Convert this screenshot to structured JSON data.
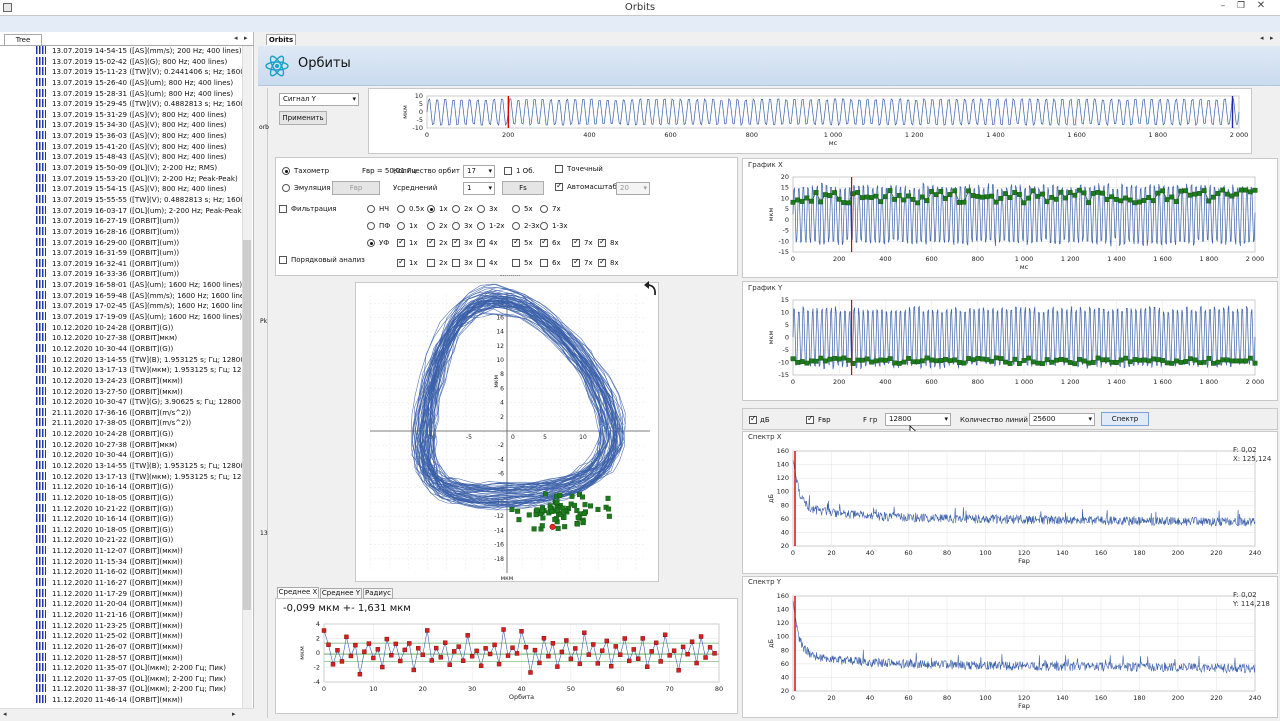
{
  "window": {
    "title": "Orbits"
  },
  "left": {
    "tab": "Tree",
    "items": [
      "13.07.2019 14-54-15 ([AS](mm/s); 200 Hz; 400 lines)",
      "13.07.2019 15-02-42 ([AS](G); 800 Hz; 400 lines)",
      "13.07.2019 15-11-23 ([TW](V); 0.2441406 s; Hz; 1600 Hz)",
      "13.07.2019 15-26-40 ([AS](um); 800 Hz; 400 lines)",
      "13.07.2019 15-28-31 ([AS](um); 800 Hz; 400 lines)",
      "13.07.2019 15-29-45 ([TW](V); 0.4882813 s; Hz; 1600 Hz)",
      "13.07.2019 15-31-29 ([AS](V); 800 Hz; 400 lines)",
      "13.07.2019 15-34-30 ([AS](V); 800 Hz; 400 lines)",
      "13.07.2019 15-36-03 ([AS](V); 800 Hz; 400 lines)",
      "13.07.2019 15-41-20 ([AS](V); 800 Hz; 400 lines)",
      "13.07.2019 15-48-43 ([AS](V); 800 Hz; 400 lines)",
      "13.07.2019 15-50-09 ([OL](V); 2-200 Hz; RMS)",
      "13.07.2019 15-53-20 ([OL](V); 2-200 Hz; Peak-Peak)",
      "13.07.2019 15-54-15 ([AS](V); 800 Hz; 400 lines)",
      "13.07.2019 15-55-55 ([TW](V); 0.4882813 s; Hz; 1600 Hz)",
      "13.07.2019 16-03-17 ([OL](um); 2-200 Hz; Peak-Peak)",
      "13.07.2019 16-27-19 ([ORBIT](um))",
      "13.07.2019 16-28-16 ([ORBIT](um))",
      "13.07.2019 16-29-00 ([ORBIT](um))",
      "13.07.2019 16-31-59 ([ORBIT](um))",
      "13.07.2019 16-32-41 ([ORBIT](um))",
      "13.07.2019 16-33-36 ([ORBIT](um))",
      "13.07.2019 16-58-01 ([AS](um); 1600 Hz; 1600 lines)",
      "13.07.2019 16-59-48 ([AS](mm/s); 1600 Hz; 1600 lines)",
      "13.07.2019 17-02-45 ([AS](mm/s); 1600 Hz; 1600 lines)",
      "13.07.2019 17-19-09 ([AS](um); 1600 Hz; 1600 lines)",
      "10.12.2020 10-24-28 ([ORBIT](G))",
      "10.12.2020 10-27-38 ([ORBIT]мкм)",
      "10.12.2020 10-30-44 ([ORBIT](G))",
      "10.12.2020 13-14-55 ([TW](B); 1.953125 s; Гц; 12800 Hz)",
      "10.12.2020 13-17-13 ([TW](мкм); 1.953125 s; Гц; 12800 H",
      "10.12.2020 13-24-23 ([ORBIT](мкм))",
      "10.12.2020 13-27-50 ([ORBIT](мкм))",
      "10.12.2020 10-30-47 ([TW](G); 3.90625 s; Гц; 12800 Hz)",
      "21.11.2020 17-36-16 ([ORBIT](m/s^2))",
      "21.11.2020 17-38-05 ([ORBIT](m/s^2))",
      "10.12.2020 10-24-28 ([ORBIT](G))",
      "10.12.2020 10-27-38 ([ORBIT]мкм)",
      "10.12.2020 10-30-44 ([ORBIT](G))",
      "10.12.2020 13-14-55 ([TW](B); 1.953125 s; Гц; 12800 Hz)",
      "10.12.2020 13-17-13 ([TW](мкм); 1.953125 s; Гц; 12800 H",
      "11.12.2020 10-16-14 ([ORBIT](G))",
      "11.12.2020 10-18-05 ([ORBIT](G))",
      "11.12.2020 10-21-22 ([ORBIT](G))",
      "11.12.2020 10-16-14 ([ORBIT](G))",
      "11.12.2020 10-18-05 ([ORBIT](G))",
      "11.12.2020 10-21-22 ([ORBIT](G))",
      "11.12.2020 11-12-07 ([ORBIT](мкм))",
      "11.12.2020 11-15-34 ([ORBIT](мкм))",
      "11.12.2020 11-16-02 ([ORBIT](мкм))",
      "11.12.2020 11-16-27 ([ORBIT](мкм))",
      "11.12.2020 11-17-29 ([ORBIT](мкм))",
      "11.12.2020 11-20-04 ([ORBIT](мкм))",
      "11.12.2020 11-21-16 ([ORBIT](мкм))",
      "11.12.2020 11-23-25 ([ORBIT](мкм))",
      "11.12.2020 11-25-02 ([ORBIT](мкм))",
      "11.12.2020 11-26-07 ([ORBIT](мкм))",
      "11.12.2020 11-28-57 ([ORBIT](мкм))",
      "11.12.2020 11-35-07 ([OL](мкм); 2-200 Гц; Пик)",
      "11.12.2020 11-37-05 ([OL](мкм); 2-200 Гц; Пик)",
      "11.12.2020 11-38-37 ([OL](мкм); 2-200 Гц; Пик)",
      "11.12.2020 11-46-14 ([ORBIT](мкм))"
    ]
  },
  "tab": {
    "label": "Orbits"
  },
  "header": {
    "title": "Орбиты"
  },
  "signal": {
    "select": "Сигнал Y",
    "apply": "Применить"
  },
  "side_labels": {
    "a": "orb",
    "b": "Pk",
    "c": "13"
  },
  "settings": {
    "tacho": "Тахометр",
    "fvr": "Fвр = 50,01 Гц",
    "orbit_count_label": "Количество орбит",
    "orbit_count": "17",
    "one_rev": "1 Об.",
    "dotted": "Точечный",
    "emulation": "Эмуляция",
    "fvr_btn": "Fвр",
    "avg_label": "Усреднений",
    "avg": "1",
    "fs_btn": "Fs",
    "autoscale": "Автомасштаб",
    "autoscale_val": "20",
    "filtering": "Фильтрация",
    "order": "Порядковый анализ",
    "row1": {
      "lead": "НЧ",
      "items": [
        "0.5x",
        "1x",
        "2x",
        "3x",
        "5x",
        "7x"
      ]
    },
    "row2": {
      "lead": "ПФ",
      "items": [
        "1x",
        "2x",
        "3x",
        "1-2x",
        "2-3x",
        "1-3x"
      ]
    },
    "row3": {
      "lead": "УФ",
      "items": [
        "1x",
        "2x",
        "3x",
        "4x",
        "5x",
        "6x",
        "7x",
        "8x"
      ]
    },
    "row4": {
      "items": [
        "1x",
        "2x",
        "3x",
        "4x",
        "5x",
        "6x",
        "7x",
        "8x"
      ]
    }
  },
  "bottom": {
    "tabs": [
      "Среднее X",
      "Среднее Y",
      "Радиус"
    ],
    "value": "-0,099 мкм +- 1,631 мкм",
    "xlabel": "Орбита",
    "ylabel": "мкм"
  },
  "spec_ctrl": {
    "db": "дБ",
    "fvr": "Fвр",
    "fgr_label": "F гр",
    "fgr": "12800",
    "lines_label": "Количество линий",
    "lines": "25600",
    "btn": "Спектр"
  },
  "charts": {
    "top": {
      "ylabel": "мкм",
      "xlabel": "мс",
      "yticks": [
        "10",
        "5",
        "0",
        "-5",
        "-10"
      ],
      "xticks": [
        "0",
        "200",
        "400",
        "600",
        "800",
        "1 000",
        "1 200",
        "1 400",
        "1 600",
        "1 800",
        "2 000"
      ]
    },
    "gx": {
      "title": "График X",
      "ylabel": "мкм",
      "xlabel": "мс",
      "yticks": [
        "20",
        "15",
        "10",
        "5",
        "0",
        "-5",
        "-10",
        "-15"
      ],
      "xticks": [
        "0",
        "200",
        "400",
        "600",
        "800",
        "1 000",
        "1 200",
        "1 400",
        "1 600",
        "1 800",
        "2 000"
      ]
    },
    "gy": {
      "title": "График Y",
      "ylabel": "мкм",
      "yticks": [
        "15",
        "10",
        "5",
        "0",
        "-5",
        "-10",
        "-15"
      ],
      "xticks": [
        "0",
        "200",
        "400",
        "600",
        "800",
        "1 000",
        "1 200",
        "1 400",
        "1 600",
        "1 800",
        "2 000"
      ]
    },
    "sx": {
      "title": "Спектр X",
      "ylabel": "дБ",
      "xlabel": "Fвр",
      "info1": "F: 0,02",
      "info2": "X: 125,124",
      "yticks": [
        "160",
        "140",
        "120",
        "100",
        "80",
        "60",
        "40",
        "20"
      ],
      "xticks": [
        "0",
        "20",
        "40",
        "60",
        "80",
        "100",
        "120",
        "140",
        "160",
        "180",
        "200",
        "220",
        "240"
      ]
    },
    "sy": {
      "title": "Спектр Y",
      "ylabel": "дБ",
      "xlabel": "Fвр",
      "info1": "F: 0,02",
      "info2": "Y: 114,218",
      "yticks": [
        "160",
        "140",
        "120",
        "100",
        "80",
        "60",
        "40",
        "20"
      ],
      "xticks": [
        "0",
        "20",
        "40",
        "60",
        "80",
        "100",
        "120",
        "140",
        "160",
        "180",
        "200",
        "220",
        "240"
      ]
    },
    "orbit": {
      "ylabel": "мкм",
      "xlabel": "мкм",
      "yticks": [
        "18",
        "16",
        "14",
        "12",
        "10",
        "8",
        "6",
        "4",
        "2",
        "0",
        "-2",
        "-4",
        "-6",
        "-8",
        "-10",
        "-12",
        "-14",
        "-16",
        "-18"
      ],
      "xticks": [
        "-10",
        "-5",
        "0",
        "5",
        "10"
      ]
    },
    "avg": {
      "yticks": [
        "4",
        "2",
        "0",
        "-2",
        "-4"
      ],
      "xticks": [
        "0",
        "10",
        "20",
        "30",
        "40",
        "50",
        "60",
        "70",
        "80"
      ]
    }
  },
  "chart_data": [
    {
      "type": "line",
      "title": "Сигнал Y",
      "xlabel": "мс",
      "ylabel": "мкм",
      "xlim": [
        0,
        2050
      ],
      "ylim": [
        -12,
        12
      ],
      "x": [
        0,
        5,
        10,
        15,
        20,
        25,
        30,
        35,
        40,
        45,
        50,
        55,
        60,
        65,
        70,
        75,
        80,
        85,
        90,
        95,
        100
      ],
      "values": [
        11,
        9,
        4,
        -3,
        -9,
        -11,
        -9,
        -4,
        3,
        9,
        11,
        9,
        4,
        -3,
        -9,
        -11,
        -9,
        -4,
        3,
        9,
        11
      ],
      "markers": [
        {
          "x": 205,
          "color": "#dd0000"
        },
        {
          "x": 2030,
          "color": "#2222aa"
        }
      ]
    },
    {
      "type": "line",
      "title": "График X",
      "xlabel": "мс",
      "ylabel": "мкм",
      "xlim": [
        0,
        2050
      ],
      "ylim": [
        -17,
        22
      ],
      "x": [
        0,
        5,
        10,
        15,
        20,
        25,
        30,
        35,
        40,
        45,
        50,
        55,
        60,
        65,
        70,
        75,
        80,
        85,
        90,
        95,
        100
      ],
      "values": [
        10,
        13,
        15,
        6,
        -8,
        -15,
        -14,
        -5,
        6,
        13,
        12,
        6,
        -8,
        -15,
        -14,
        -5,
        6,
        13,
        15,
        8,
        -5
      ],
      "series": [
        {
          "name": "1x",
          "values": [
            10,
            11,
            9,
            8,
            12,
            10,
            9,
            11,
            13,
            10,
            8,
            9,
            12,
            11,
            10,
            9,
            11,
            12,
            10,
            9,
            11
          ]
        }
      ],
      "marker": 260
    },
    {
      "type": "line",
      "title": "График Y",
      "xlabel": "мс",
      "ylabel": "мкм",
      "xlim": [
        0,
        2050
      ],
      "ylim": [
        -17,
        17
      ],
      "x": [
        0,
        5,
        10,
        15,
        20,
        25,
        30,
        35,
        40,
        45,
        50,
        55,
        60,
        65,
        70,
        75,
        80,
        85,
        90,
        95,
        100
      ],
      "values": [
        12,
        10,
        4,
        -4,
        -10,
        -12,
        -10,
        -4,
        4,
        10,
        12,
        10,
        4,
        -4,
        -10,
        -12,
        -10,
        -4,
        4,
        10,
        12
      ],
      "series": [
        {
          "name": "1x",
          "values": [
            -11,
            -10,
            -12,
            -11,
            -10,
            -11,
            -12,
            -10,
            -11,
            -11,
            -12,
            -10,
            -11,
            -10,
            -12,
            -11,
            -10,
            -11,
            -12,
            -11,
            -10
          ]
        }
      ],
      "marker": 260
    },
    {
      "type": "line",
      "title": "Спектр X",
      "xlabel": "Fвр",
      "ylabel": "дБ",
      "xlim": [
        0,
        256
      ],
      "ylim": [
        20,
        165
      ],
      "x": [
        0,
        2,
        5,
        10,
        20,
        30,
        40,
        60,
        80,
        100,
        120,
        140,
        160,
        180,
        200,
        220,
        240,
        256
      ],
      "values": [
        155,
        115,
        95,
        80,
        75,
        72,
        70,
        68,
        67,
        66,
        65,
        65,
        64,
        64,
        64,
        63,
        63,
        62
      ]
    },
    {
      "type": "line",
      "title": "Спектр Y",
      "xlabel": "Fвр",
      "ylabel": "дБ",
      "xlim": [
        0,
        256
      ],
      "ylim": [
        20,
        165
      ],
      "x": [
        0,
        2,
        5,
        10,
        20,
        30,
        40,
        60,
        80,
        100,
        120,
        140,
        160,
        180,
        200,
        220,
        240,
        256
      ],
      "values": [
        158,
        120,
        100,
        85,
        78,
        74,
        72,
        68,
        66,
        65,
        64,
        63,
        62,
        62,
        61,
        61,
        60,
        60
      ]
    },
    {
      "type": "scatter",
      "title": "Орбиты",
      "xlabel": "мкм",
      "ylabel": "мкм",
      "xlim": [
        -18,
        18
      ],
      "ylim": [
        -19,
        19
      ],
      "points": [
        [
          4,
          -12
        ],
        [
          6,
          -11
        ],
        [
          8,
          -12
        ],
        [
          7,
          -10
        ],
        [
          9,
          -11
        ],
        [
          10,
          -12
        ],
        [
          5,
          -13
        ],
        [
          11,
          -10
        ],
        [
          6,
          -12
        ],
        [
          8,
          -10
        ],
        [
          3,
          -12
        ],
        [
          9,
          -13
        ],
        [
          7,
          -12
        ],
        [
          10,
          -10
        ],
        [
          12,
          -11
        ],
        [
          5,
          -11
        ],
        [
          8,
          -11
        ]
      ],
      "marker": [
        6,
        -13.5
      ]
    },
    {
      "type": "scatter",
      "title": "Среднее X",
      "xlabel": "Орбита",
      "ylabel": "мкм",
      "xlim": [
        0,
        88
      ],
      "ylim": [
        -5,
        5
      ],
      "x": [
        1,
        3,
        5,
        7,
        9,
        11,
        13,
        15,
        17,
        19,
        21,
        23,
        25,
        27,
        29,
        31,
        33,
        35,
        37,
        39,
        41,
        43,
        45,
        47,
        49,
        51,
        53,
        55,
        57,
        59,
        61,
        63,
        65,
        67,
        69,
        71,
        73,
        75,
        77,
        79,
        81,
        83,
        85,
        87
      ],
      "values": [
        3.5,
        1.2,
        -2.8,
        0.5,
        -1.5,
        2.8,
        -0.8,
        1.9,
        -3.2,
        0.2,
        2.4,
        -1.1,
        0.9,
        -2.2,
        3.1,
        -0.4,
        1.5,
        -1.8,
        0.6,
        2.2,
        -2.9,
        1.1,
        -0.3,
        3.4,
        -1.6,
        0.8,
        -0.9,
        2.6,
        -2.1,
        0.3,
        1.7,
        -1.3,
        2.9,
        -0.6,
        0.4,
        -2.5,
        1.3,
        -0.2,
        2.1,
        -1.7,
        3.6,
        -0.7,
        1.0,
        -0.1
      ]
    }
  ]
}
